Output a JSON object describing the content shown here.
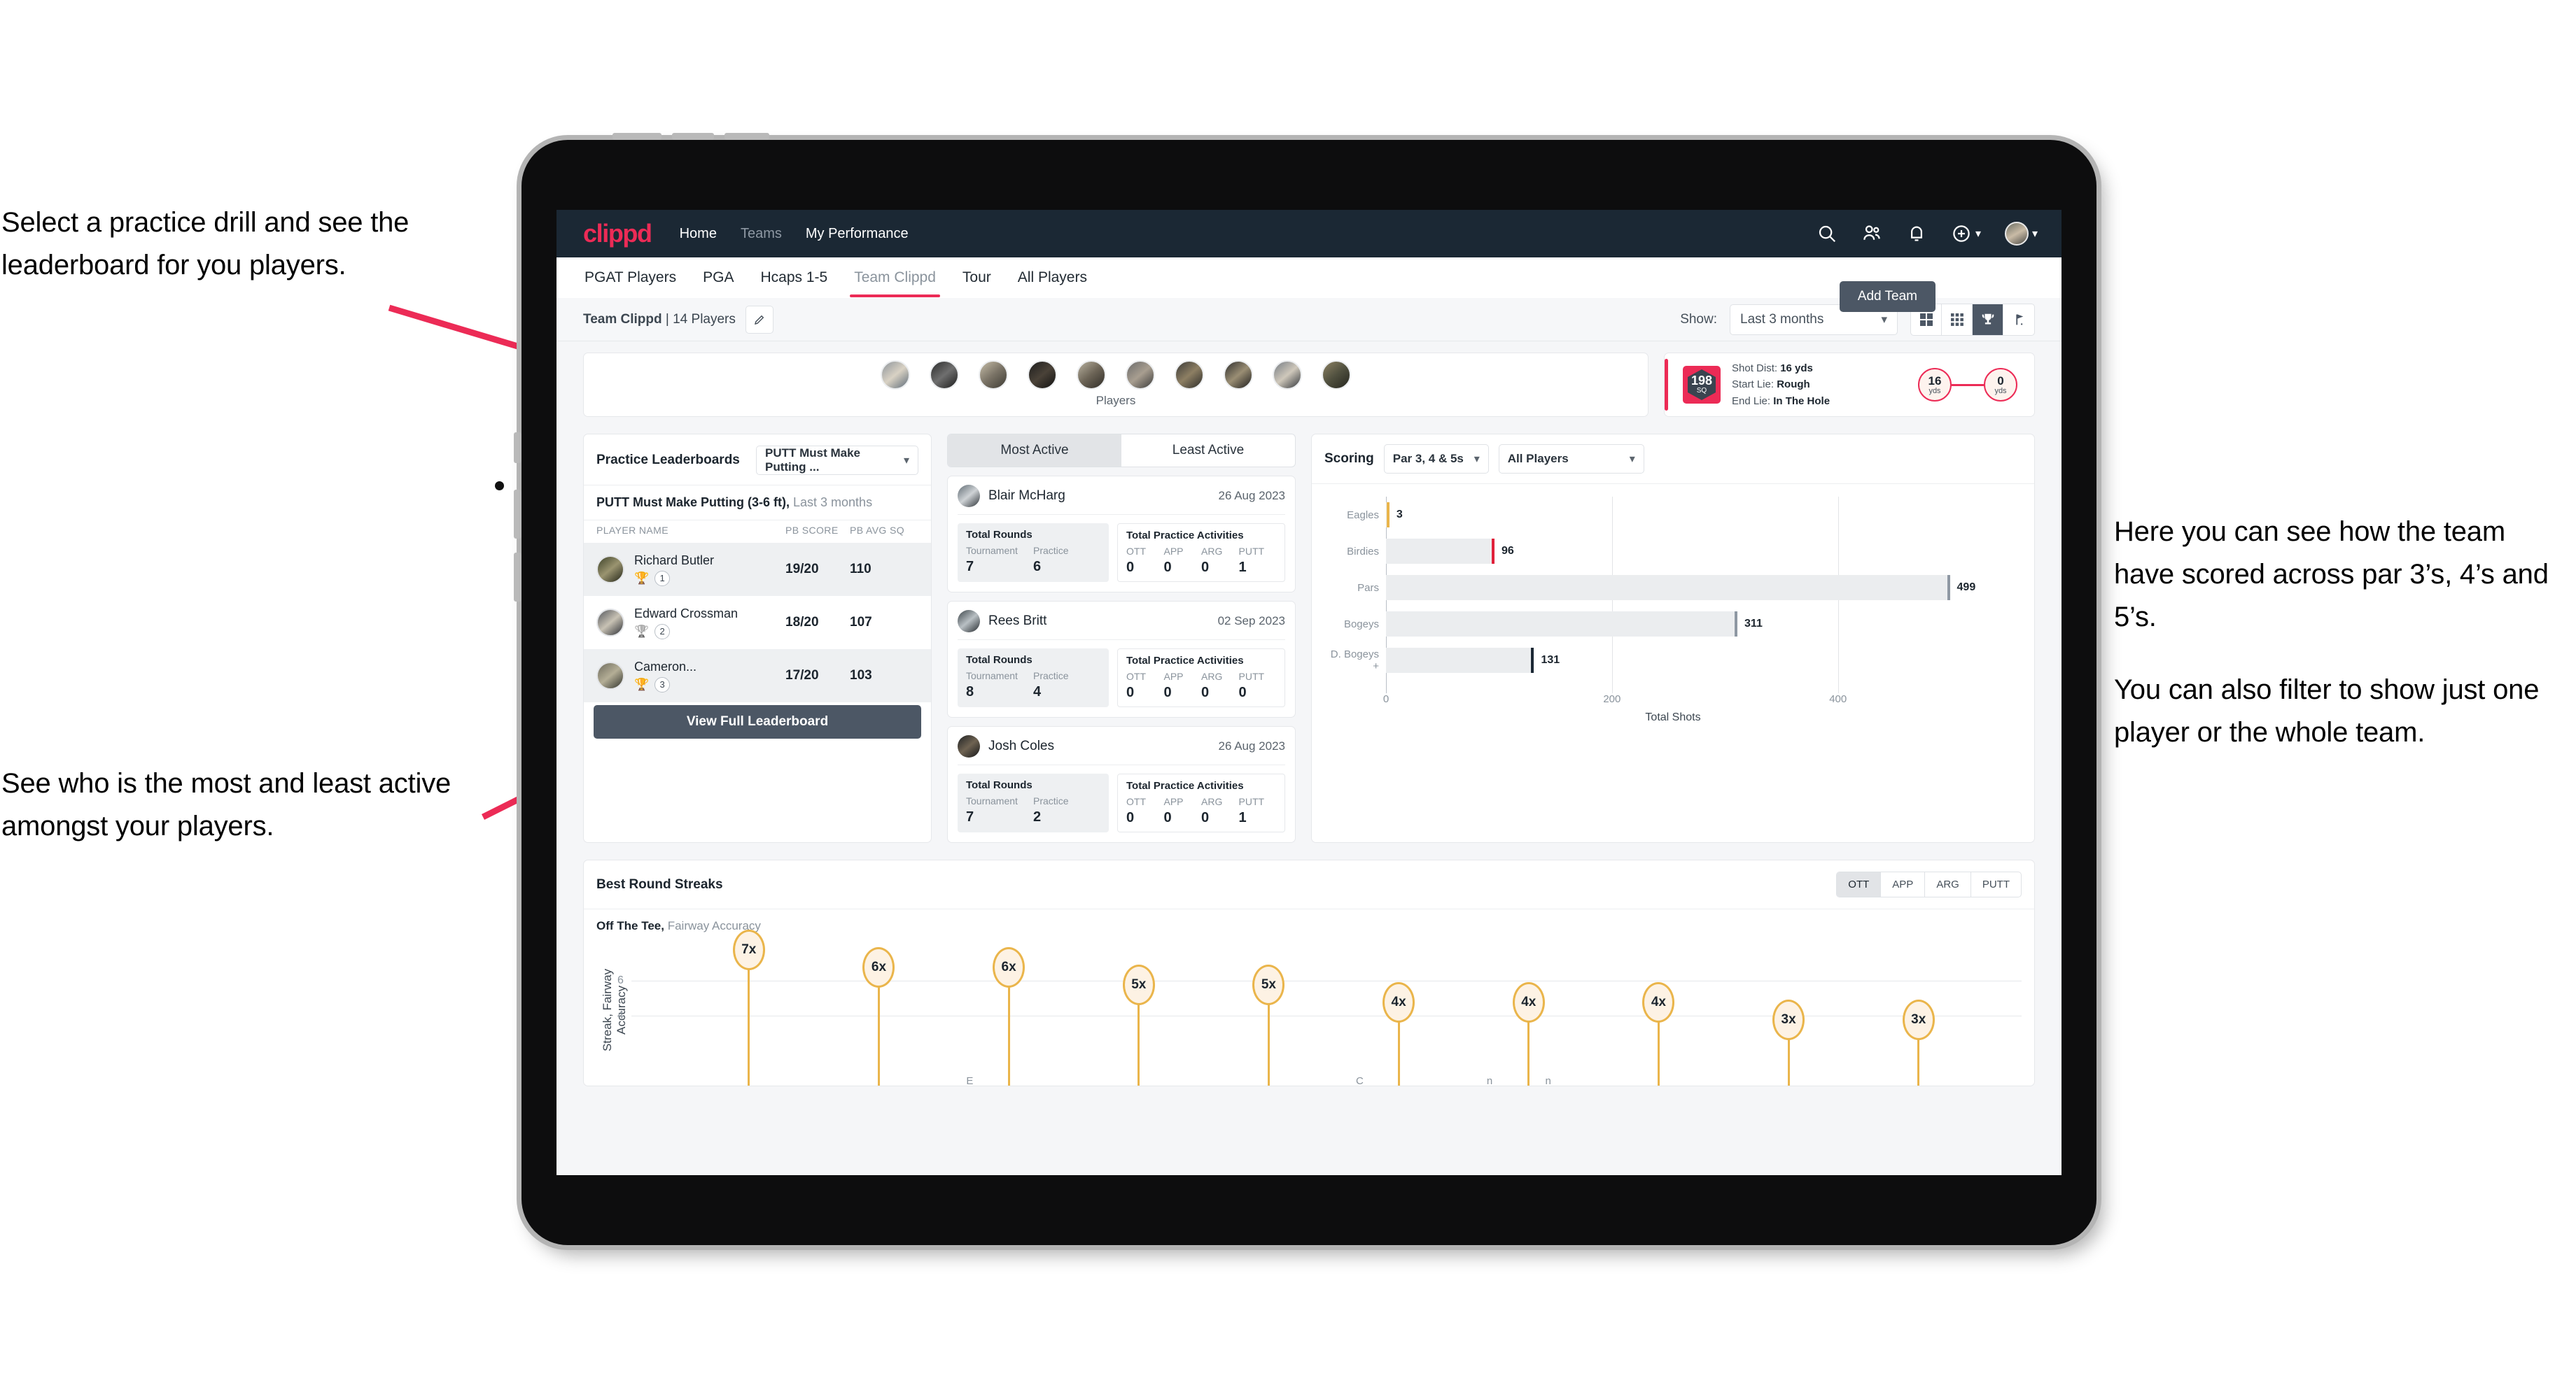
{
  "annotations": {
    "left_top": "Select a practice drill and see the leaderboard for you players.",
    "left_bottom": "See who is the most and least active amongst your players.",
    "right_p1": "Here you can see how the team have scored across par 3’s, 4’s and 5’s.",
    "right_p2": "You can also filter to show just one player or the whole team.",
    "arrow_color": "#ec2b56"
  },
  "navbar": {
    "logo": "clippd",
    "links": [
      {
        "label": "Home",
        "active": true
      },
      {
        "label": "Teams",
        "active": false
      },
      {
        "label": "My Performance",
        "active": true
      }
    ],
    "icons": [
      "search-icon",
      "people-icon",
      "bell-icon",
      "plus-circle-icon",
      "avatar"
    ],
    "brand_color": "#ec2b56",
    "bar_color": "#1b2834"
  },
  "tabs": {
    "items": [
      "PGAT Players",
      "PGA",
      "Hcaps 1-5",
      "Team Clippd",
      "Tour",
      "All Players"
    ],
    "active": "Team Clippd",
    "add_team_label": "Add Team"
  },
  "subbar": {
    "team_name": "Team Clippd",
    "team_count": "| 14 Players",
    "edit_icon": "pencil-icon",
    "show_label": "Show:",
    "show_value": "Last 3 months",
    "view_toggle": [
      "grid-large-icon",
      "grid-small-icon",
      "trophy-icon",
      "flag-icon"
    ],
    "view_active_index": 2
  },
  "players_strip": {
    "caption": "Players",
    "count": 10
  },
  "shot_card": {
    "sq_value": "198",
    "sq_label": "SQ",
    "lines": [
      {
        "key": "Shot Dist:",
        "value": "16 yds"
      },
      {
        "key": "Start Lie:",
        "value": "Rough"
      },
      {
        "key": "End Lie:",
        "value": "In The Hole"
      }
    ],
    "start": {
      "value": "16",
      "unit": "yds"
    },
    "end": {
      "value": "0",
      "unit": "yds"
    }
  },
  "leaderboard": {
    "title": "Practice Leaderboards",
    "drill_select": "PUTT Must Make Putting ...",
    "subtitle_bold": "PUTT Must Make Putting (3-6 ft),",
    "subtitle_rest": " Last 3 months",
    "columns": [
      "PLAYER NAME",
      "PB SCORE",
      "PB AVG SQ"
    ],
    "rows": [
      {
        "name": "Richard Butler",
        "rank": "1",
        "trophy": "gold",
        "score": "19/20",
        "avg_sq": "110"
      },
      {
        "name": "Edward Crossman",
        "rank": "2",
        "trophy": "silver",
        "score": "18/20",
        "avg_sq": "107"
      },
      {
        "name": "Cameron...",
        "rank": "3",
        "trophy": "bronze",
        "score": "17/20",
        "avg_sq": "103"
      }
    ],
    "button": "View Full Leaderboard"
  },
  "activity": {
    "tabs": [
      "Most Active",
      "Least Active"
    ],
    "active_tab": "Most Active",
    "rounds_label": "Total Rounds",
    "rounds_keys": [
      "Tournament",
      "Practice"
    ],
    "practice_label": "Total Practice Activities",
    "practice_keys": [
      "OTT",
      "APP",
      "ARG",
      "PUTT"
    ],
    "cards": [
      {
        "name": "Blair McHarg",
        "date": "26 Aug 2023",
        "rounds": [
          "7",
          "6"
        ],
        "practice": [
          "0",
          "0",
          "0",
          "1"
        ]
      },
      {
        "name": "Rees Britt",
        "date": "02 Sep 2023",
        "rounds": [
          "8",
          "4"
        ],
        "practice": [
          "0",
          "0",
          "0",
          "0"
        ]
      },
      {
        "name": "Josh Coles",
        "date": "26 Aug 2023",
        "rounds": [
          "7",
          "2"
        ],
        "practice": [
          "0",
          "0",
          "0",
          "1"
        ]
      }
    ]
  },
  "scoring": {
    "title": "Scoring",
    "par_select": "Par 3, 4 & 5s",
    "player_select": "All Players",
    "chart_data": {
      "type": "bar",
      "orientation": "horizontal",
      "title": "Scoring",
      "categories": [
        "Eagles",
        "Birdies",
        "Pars",
        "Bogeys",
        "D. Bogeys +"
      ],
      "values": [
        3,
        96,
        499,
        311,
        131
      ],
      "cap_colors": [
        "#eab54b",
        "#e0213a",
        "#8e98a3",
        "#8e98a3",
        "#1b2834"
      ],
      "bar_color": "#ebedef",
      "xlabel": "Total Shots",
      "ylabel": "",
      "xlim": [
        0,
        560
      ],
      "xticks": [
        0,
        200,
        400
      ],
      "grid": true,
      "legend": "none"
    }
  },
  "streaks": {
    "title": "Best Round Streaks",
    "toggle": [
      "OTT",
      "APP",
      "ARG",
      "PUTT"
    ],
    "toggle_active": "OTT",
    "sub_bold": "Off The Tee,",
    "sub_rest": " Fairway Accuracy",
    "chart_data": {
      "type": "bar",
      "title": "Off The Tee, Fairway Accuracy",
      "ylabel": "Streak, Fairway Accuracy",
      "xlabel": "",
      "yticks": [
        4,
        6
      ],
      "ylim": [
        0,
        8
      ],
      "labels": [
        "7x",
        "6x",
        "6x",
        "5x",
        "5x",
        "4x",
        "4x",
        "4x",
        "3x",
        "3x"
      ],
      "values": [
        7,
        6,
        6,
        5,
        5,
        4,
        4,
        4,
        3,
        3
      ],
      "marker_color": "#eab54b",
      "marker_fill": "#fdf2e4"
    }
  }
}
